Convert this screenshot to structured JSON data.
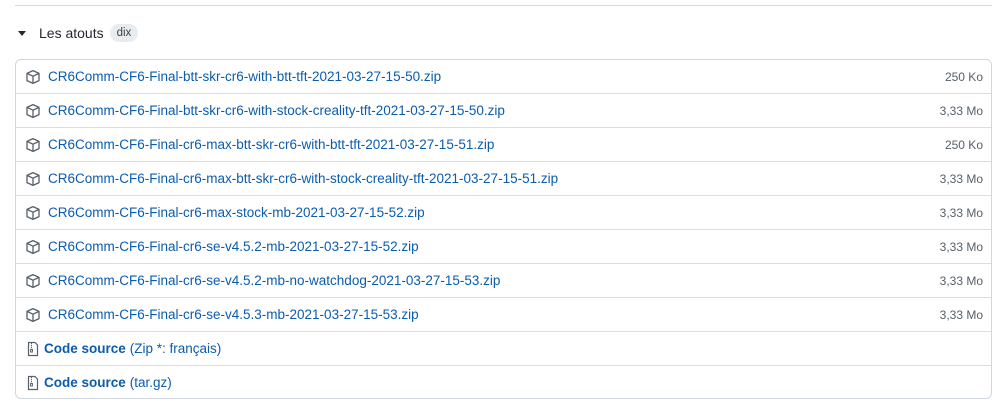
{
  "release": {
    "assets_label": "Les atouts",
    "assets_count": "dix",
    "assets": [
      {
        "name": "CR6Comm-CF6-Final-btt-skr-cr6-with-btt-tft-2021-03-27-15-50.zip",
        "size": "250 Ko",
        "icon": "package-icon"
      },
      {
        "name": "CR6Comm-CF6-Final-btt-skr-cr6-with-stock-creality-tft-2021-03-27-15-50.zip",
        "size": "3,33 Mo",
        "icon": "package-icon"
      },
      {
        "name": "CR6Comm-CF6-Final-cr6-max-btt-skr-cr6-with-btt-tft-2021-03-27-15-51.zip",
        "size": "250 Ko",
        "icon": "package-icon"
      },
      {
        "name": "CR6Comm-CF6-Final-cr6-max-btt-skr-cr6-with-stock-creality-tft-2021-03-27-15-51.zip",
        "size": "3,33 Mo",
        "icon": "package-icon"
      },
      {
        "name": "CR6Comm-CF6-Final-cr6-max-stock-mb-2021-03-27-15-52.zip",
        "size": "3,33 Mo",
        "icon": "package-icon"
      },
      {
        "name": "CR6Comm-CF6-Final-cr6-se-v4.5.2-mb-2021-03-27-15-52.zip",
        "size": "3,33 Mo",
        "icon": "package-icon"
      },
      {
        "name": "CR6Comm-CF6-Final-cr6-se-v4.5.2-mb-no-watchdog-2021-03-27-15-53.zip",
        "size": "3,33 Mo",
        "icon": "package-icon"
      },
      {
        "name": "CR6Comm-CF6-Final-cr6-se-v4.5.3-mb-2021-03-27-15-53.zip",
        "size": "3,33 Mo",
        "icon": "package-icon"
      }
    ],
    "source_code": [
      {
        "label": "Code source",
        "ext": "(Zip *: français)",
        "icon": "file-zip-icon"
      },
      {
        "label": "Code source",
        "ext": "(tar.gz)",
        "icon": "file-zip-icon"
      }
    ]
  },
  "colors": {
    "link": "#0b5cad",
    "border": "#d0d7de",
    "muted": "#57606a",
    "icon": "#57606a"
  }
}
